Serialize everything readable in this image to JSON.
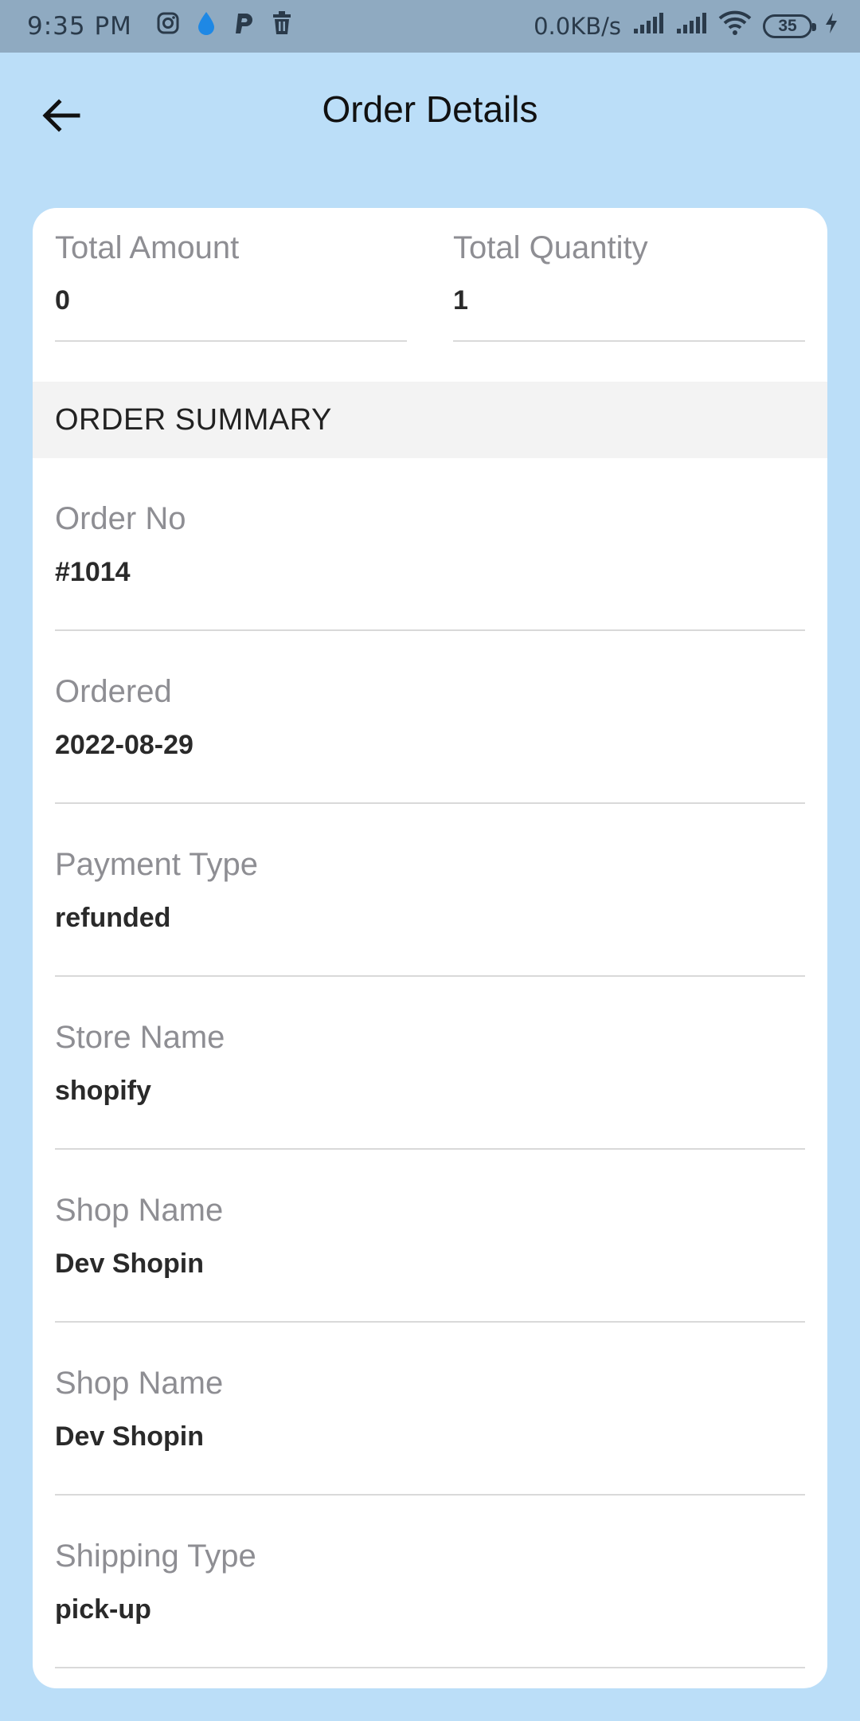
{
  "status_bar": {
    "time": "9:35 PM",
    "net_speed": "0.0KB/s",
    "battery": "35",
    "icons": [
      "instagram-icon",
      "water-drop-icon",
      "p-app-icon",
      "trash-icon",
      "signal-icon",
      "signal-icon",
      "wifi-icon",
      "battery-icon",
      "charging-icon"
    ]
  },
  "header": {
    "title": "Order Details",
    "back_icon": "arrow-left-icon"
  },
  "totals": {
    "amount_label": "Total Amount",
    "amount_value": "0",
    "quantity_label": "Total Quantity",
    "quantity_value": "1"
  },
  "summary": {
    "heading": "ORDER SUMMARY",
    "items": [
      {
        "label": "Order No",
        "value": "#1014"
      },
      {
        "label": "Ordered",
        "value": "2022-08-29"
      },
      {
        "label": "Payment Type",
        "value": "refunded"
      },
      {
        "label": "Store Name",
        "value": "shopify"
      },
      {
        "label": "Shop Name",
        "value": "Dev Shopin"
      },
      {
        "label": "Shop Name",
        "value": "Dev Shopin"
      },
      {
        "label": "Shipping Type",
        "value": "pick-up"
      }
    ]
  },
  "colors": {
    "background": "#bbdef8",
    "status_bar": "#8faac1",
    "card": "#ffffff",
    "label_gray": "#8e8e93",
    "section_bg": "#f3f3f3"
  }
}
